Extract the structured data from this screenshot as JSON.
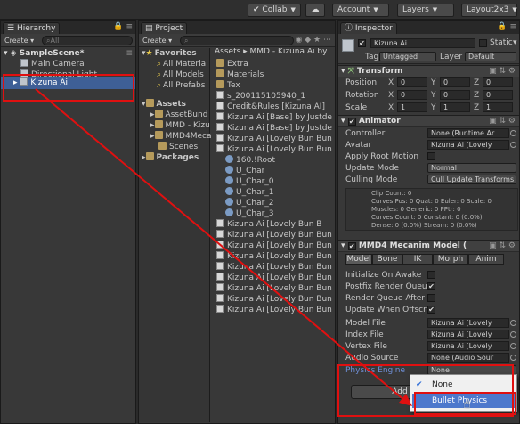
{
  "toolbar": {
    "collab": "Collab",
    "account": "Account",
    "layers": "Layers",
    "layout": "Layout2x3"
  },
  "hierarchy": {
    "tab": "Hierarchy",
    "create": "Create",
    "search_placeholder": "All",
    "scene": "SampleScene*",
    "items": [
      "Main Camera",
      "Directional Light",
      "Kizuna Ai"
    ]
  },
  "project": {
    "tab": "Project",
    "create": "Create",
    "favorites": "Favorites",
    "fav_items": [
      "All Materia",
      "All Models",
      "All Prefabs"
    ],
    "assets": "Assets",
    "asset_items": [
      "AssetBund",
      "MMD - Kizu",
      "MMD4Meca",
      "Scenes"
    ],
    "packages": "Packages",
    "breadcrumb": "Assets ▸ MMD - Kizuna Ai by",
    "files": [
      "Extra",
      "Materials",
      "Tex",
      "s_200115105940_1",
      "Credit&Rules [Kizuna AI]",
      "Kizuna Ai [Base] by Justde",
      "Kizuna Ai [Base] by Justde",
      "Kizuna Ai [Lovely Bun Bun",
      "Kizuna Ai [Lovely Bun Bun",
      "160.!Root",
      "U_Char",
      "U_Char_0",
      "U_Char_1",
      "U_Char_2",
      "U_Char_3",
      "Kizuna Ai [Lovely Bun B",
      "Kizuna Ai [Lovely Bun Bun",
      "Kizuna Ai [Lovely Bun Bun",
      "Kizuna Ai [Lovely Bun Bun",
      "Kizuna Ai [Lovely Bun Bun",
      "Kizuna Ai [Lovely Bun Bun",
      "Kizuna Ai [Lovely Bun Bun",
      "Kizuna Ai [Lovely Bun Bun",
      "Kizuna Ai [Lovely Bun Bun"
    ]
  },
  "inspector": {
    "tab": "Inspector",
    "object_name": "Kizuna Ai",
    "static": "Static",
    "tag_label": "Tag",
    "tag_value": "Untagged",
    "layer_label": "Layer",
    "layer_value": "Default",
    "transform": {
      "title": "Transform",
      "rows": [
        {
          "label": "Position",
          "x": "0",
          "y": "0",
          "z": "0"
        },
        {
          "label": "Rotation",
          "x": "0",
          "y": "0",
          "z": "0"
        },
        {
          "label": "Scale",
          "x": "1",
          "y": "1",
          "z": "1"
        }
      ]
    },
    "animator": {
      "title": "Animator",
      "controller_label": "Controller",
      "controller_value": "None (Runtime Ar",
      "avatar_label": "Avatar",
      "avatar_value": "Kizuna Ai [Lovely",
      "root_motion_label": "Apply Root Motion",
      "update_mode_label": "Update Mode",
      "update_mode_value": "Normal",
      "culling_label": "Culling Mode",
      "culling_value": "Cull Update Transforms",
      "info": [
        "Clip Count: 0",
        "Curves Pos: 0 Quat: 0 Euler: 0 Scale: 0",
        "Muscles: 0 Generic: 0 PPtr: 0",
        "Curves Count: 0 Constant: 0 (0.0%)",
        "Dense: 0 (0.0%) Stream: 0 (0.0%)"
      ]
    },
    "mmd4": {
      "title": "MMD4 Mecanim Model (",
      "tabs": [
        "Model",
        "Bone",
        "IK",
        "Morph",
        "Anim"
      ],
      "rows": [
        "Initialize On Awake",
        "Postfix Render Queu",
        "Render Queue After",
        "Update When Offscre"
      ],
      "model_file_label": "Model File",
      "model_file_value": "Kizuna Ai [Lovely",
      "index_file_label": "Index File",
      "index_file_value": "Kizuna Ai [Lovely",
      "vertex_file_label": "Vertex File",
      "vertex_file_value": "Kizuna Ai [Lovely",
      "audio_label": "Audio Source",
      "audio_value": "None (Audio Sour",
      "physics_label": "Physics Engine",
      "physics_value": "None",
      "add_button": "Add"
    },
    "dropdown": {
      "options": [
        "None",
        "Bullet Physics"
      ]
    }
  },
  "colors": {
    "selection": "#3e5f96",
    "highlight_red": "#e01010",
    "dropdown_hover": "#4d78cc"
  }
}
